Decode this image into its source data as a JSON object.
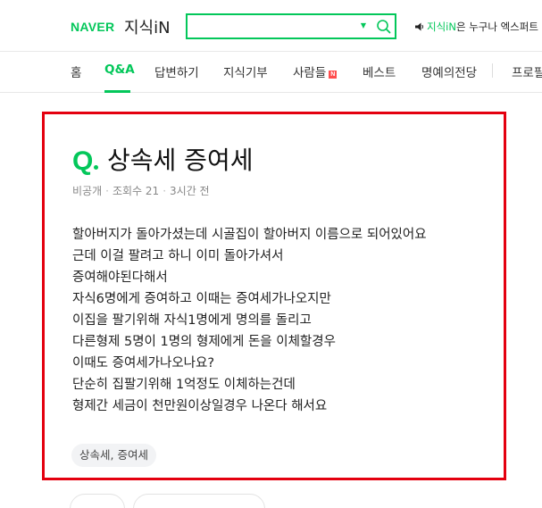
{
  "header": {
    "logo_naver": "NAVER",
    "logo_kin": "지식iN",
    "search": {
      "value": "",
      "placeholder": ""
    },
    "notice_prefix": "지식iN",
    "notice_rest": "은 누구나 엑스퍼트"
  },
  "nav": {
    "items": [
      {
        "label": "홈"
      },
      {
        "label": "Q&A"
      },
      {
        "label": "답변하기"
      },
      {
        "label": "지식기부"
      },
      {
        "label": "사람들"
      },
      {
        "label": "베스트"
      },
      {
        "label": "명예의전당"
      },
      {
        "label": "프로필"
      }
    ],
    "new_badge": "N",
    "active_index": 1
  },
  "question": {
    "q_mark": "Q",
    "title": "상속세 증여세",
    "author": "비공개",
    "views_label": "조회수",
    "views": "21",
    "time": "3시간 전",
    "sep": "·",
    "body": [
      "할아버지가 돌아가셨는데 시골집이 할아버지 이름으로 되어있어요",
      "근데 이걸 팔려고 하니 이미 돌아가셔서",
      "증여해야된다해서",
      "자식6명에게 증여하고 이때는 증여세가나오지만",
      "이집을 팔기위해 자식1명에게 명의를 돌리고",
      "다른형제 5명이 1명의 형제에게 돈을 이체할경우",
      "이때도 증여세가나오나요?",
      "단순히 집팔기위해 1억정도 이체하는건데",
      "형제간 세금이 천만원이상일경우 나온다 해서요"
    ],
    "tag": "상속세, 증여세"
  },
  "colors": {
    "brand": "#03c75a",
    "highlight_border": "#e4000f",
    "new_badge": "#ff4d4d"
  }
}
